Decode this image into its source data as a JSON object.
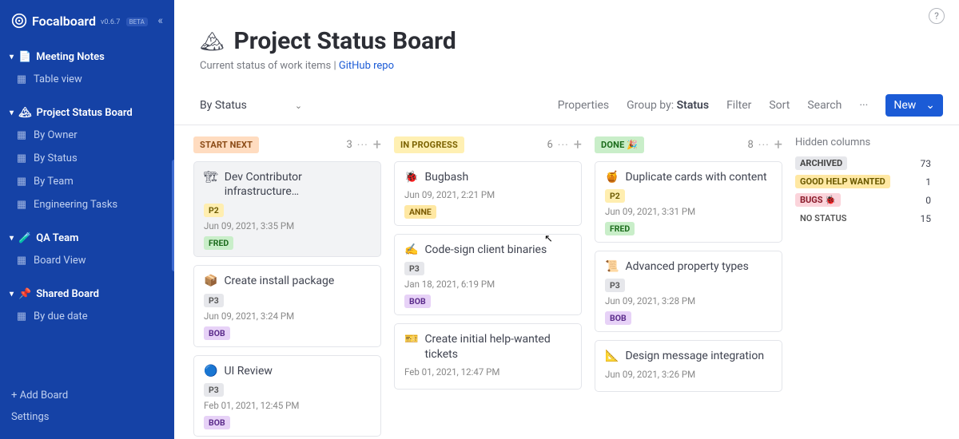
{
  "app": {
    "name": "Focalboard",
    "version": "v0.6.7",
    "beta": "BETA"
  },
  "sidebar": {
    "groups": [
      {
        "label": "Meeting Notes",
        "icon": "📄",
        "items": [
          {
            "label": "Table view",
            "icon": "▦"
          }
        ]
      },
      {
        "label": "Project Status Board",
        "icon": "🏔",
        "items": [
          {
            "label": "By Owner",
            "icon": "▦"
          },
          {
            "label": "By Status",
            "icon": "▦"
          },
          {
            "label": "By Team",
            "icon": "▦"
          },
          {
            "label": "Engineering Tasks",
            "icon": "▦"
          }
        ]
      },
      {
        "label": "QA Team",
        "icon": "🧪",
        "items": [
          {
            "label": "Board View",
            "icon": "▦"
          }
        ]
      },
      {
        "label": "Shared Board",
        "icon": "📌",
        "items": [
          {
            "label": "By due date",
            "icon": "▦"
          }
        ]
      }
    ],
    "addBoard": "+ Add Board",
    "settings": "Settings"
  },
  "header": {
    "icon": "🏔",
    "title": "Project Status Board",
    "subtitlePrefix": "Current status of work items | ",
    "subtitleLink": "GitHub repo"
  },
  "toolbar": {
    "view": "By Status",
    "properties": "Properties",
    "groupByLabel": "Group by: ",
    "groupByValue": "Status",
    "filter": "Filter",
    "sort": "Sort",
    "search": "Search",
    "more": "···",
    "newLabel": "New"
  },
  "columns": [
    {
      "label": "START NEXT",
      "bg": "#ffdcc0",
      "fg": "#8a4a15",
      "count": "3",
      "cards": [
        {
          "icon": "🏗",
          "title": "Dev Contributor infrastructure…",
          "priority": "P2",
          "pclass": "p2",
          "date": "Jun 09, 2021, 3:35 PM",
          "owner": "FRED",
          "oclass": "fred",
          "sel": true
        },
        {
          "icon": "📦",
          "title": "Create install package",
          "priority": "P3",
          "pclass": "p3",
          "date": "Jun 09, 2021, 3:24 PM",
          "owner": "BOB",
          "oclass": "bob"
        },
        {
          "icon": "🔵",
          "title": "UI Review",
          "priority": "P3",
          "pclass": "p3",
          "date": "Feb 01, 2021, 12:45 PM",
          "owner": "BOB",
          "oclass": "bob"
        }
      ]
    },
    {
      "label": "IN PROGRESS",
      "bg": "#fff0b3",
      "fg": "#7a6200",
      "count": "6",
      "cards": [
        {
          "icon": "🐞",
          "title": "Bugbash",
          "priority": "",
          "pclass": "",
          "date": "Jun 09, 2021, 2:21 PM",
          "owner": "ANNE",
          "oclass": "anne"
        },
        {
          "icon": "✍️",
          "title": "Code-sign client binaries",
          "priority": "P3",
          "pclass": "p3",
          "date": "Jan 18, 2021, 6:19 PM",
          "owner": "BOB",
          "oclass": "bob"
        },
        {
          "icon": "🎫",
          "title": "Create initial help-wanted tickets",
          "priority": "",
          "pclass": "",
          "date": "Feb 01, 2021, 12:47 PM",
          "owner": "",
          "oclass": ""
        }
      ]
    },
    {
      "label": "DONE 🎉",
      "bg": "#c9eec9",
      "fg": "#1a6b1a",
      "count": "8",
      "cards": [
        {
          "icon": "🍯",
          "title": "Duplicate cards with content",
          "priority": "P2",
          "pclass": "p2",
          "date": "Jun 09, 2021, 3:31 PM",
          "owner": "FRED",
          "oclass": "fred"
        },
        {
          "icon": "📜",
          "title": "Advanced property types",
          "priority": "P3",
          "pclass": "p3",
          "date": "Jun 09, 2021, 3:28 PM",
          "owner": "BOB",
          "oclass": "bob"
        },
        {
          "icon": "📐",
          "title": "Design message integration",
          "priority": "",
          "pclass": "",
          "date": "Jun 09, 2021, 3:26 PM",
          "owner": "",
          "oclass": ""
        }
      ]
    }
  ],
  "hidden": {
    "header": "Hidden columns",
    "rows": [
      {
        "label": "ARCHIVED",
        "cls": "h-arch",
        "count": "73"
      },
      {
        "label": "GOOD HELP WANTED",
        "cls": "h-good",
        "count": "1"
      },
      {
        "label": "BUGS 🐞",
        "cls": "h-bugs",
        "count": "0"
      },
      {
        "label": "NO STATUS",
        "cls": "h-none",
        "count": "15"
      }
    ]
  }
}
